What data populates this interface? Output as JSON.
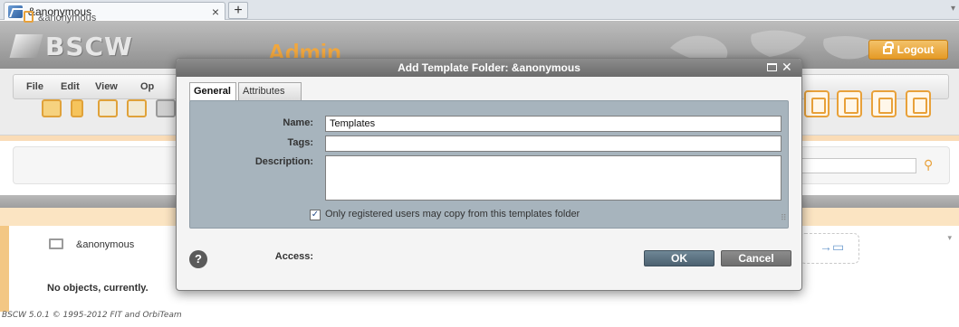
{
  "browser": {
    "tab_title": "&anonymous",
    "tab_close": "×",
    "new_tab": "+"
  },
  "app": {
    "logo": "BSCW",
    "section_title": "Admin",
    "logout_label": "Logout",
    "menu": [
      "File",
      "Edit",
      "View",
      "Op"
    ],
    "breadcrumb": "&anonymous",
    "folder_name": "&anonymous",
    "empty_message": "No objects, currently.",
    "footer": "BSCW 5.0.1 © 1995-2012 FIT and OrbiTeam"
  },
  "dialog": {
    "title": "Add Template Folder: &anonymous",
    "tabs": [
      {
        "label": "General",
        "active": true
      },
      {
        "label": "Attributes",
        "active": false
      }
    ],
    "fields": {
      "name_label": "Name:",
      "name_value": "Templates",
      "tags_label": "Tags:",
      "tags_value": "",
      "description_label": "Description:",
      "description_value": "",
      "access_label": "Access:",
      "access_checked": true,
      "access_text": "Only registered users may copy from this templates folder"
    },
    "help": "?",
    "ok_label": "OK",
    "cancel_label": "Cancel"
  },
  "colors": {
    "accent": "#f1a73e",
    "panel": "#a7b4bd",
    "ok_button": "#5d7382"
  },
  "icons": [
    "bscw-tab-icon",
    "logout-lock-icon",
    "help-icon",
    "close-icon",
    "maximize-icon",
    "folder-icon",
    "clipboard-icon",
    "search-key-icon"
  ]
}
